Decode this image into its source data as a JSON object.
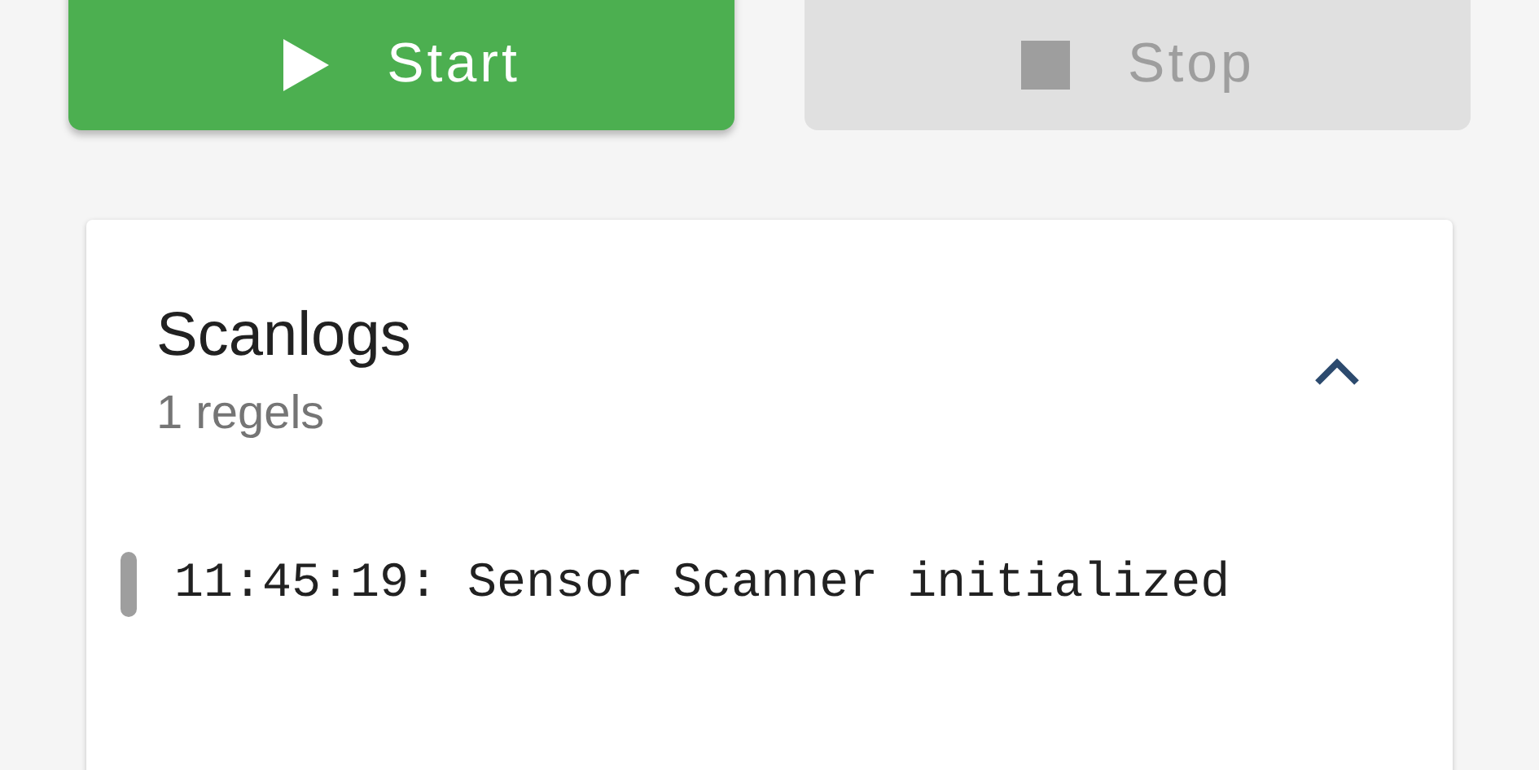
{
  "buttons": [
    {
      "label": "Start",
      "kind": "play",
      "disabled": false
    },
    {
      "label": "Stop",
      "kind": "stop",
      "disabled": true
    }
  ],
  "log_panel": {
    "title": "Scanlogs",
    "subtitle": "1 regels",
    "expanded": true,
    "lines": [
      "11:45:19: Sensor Scanner initialized"
    ]
  }
}
